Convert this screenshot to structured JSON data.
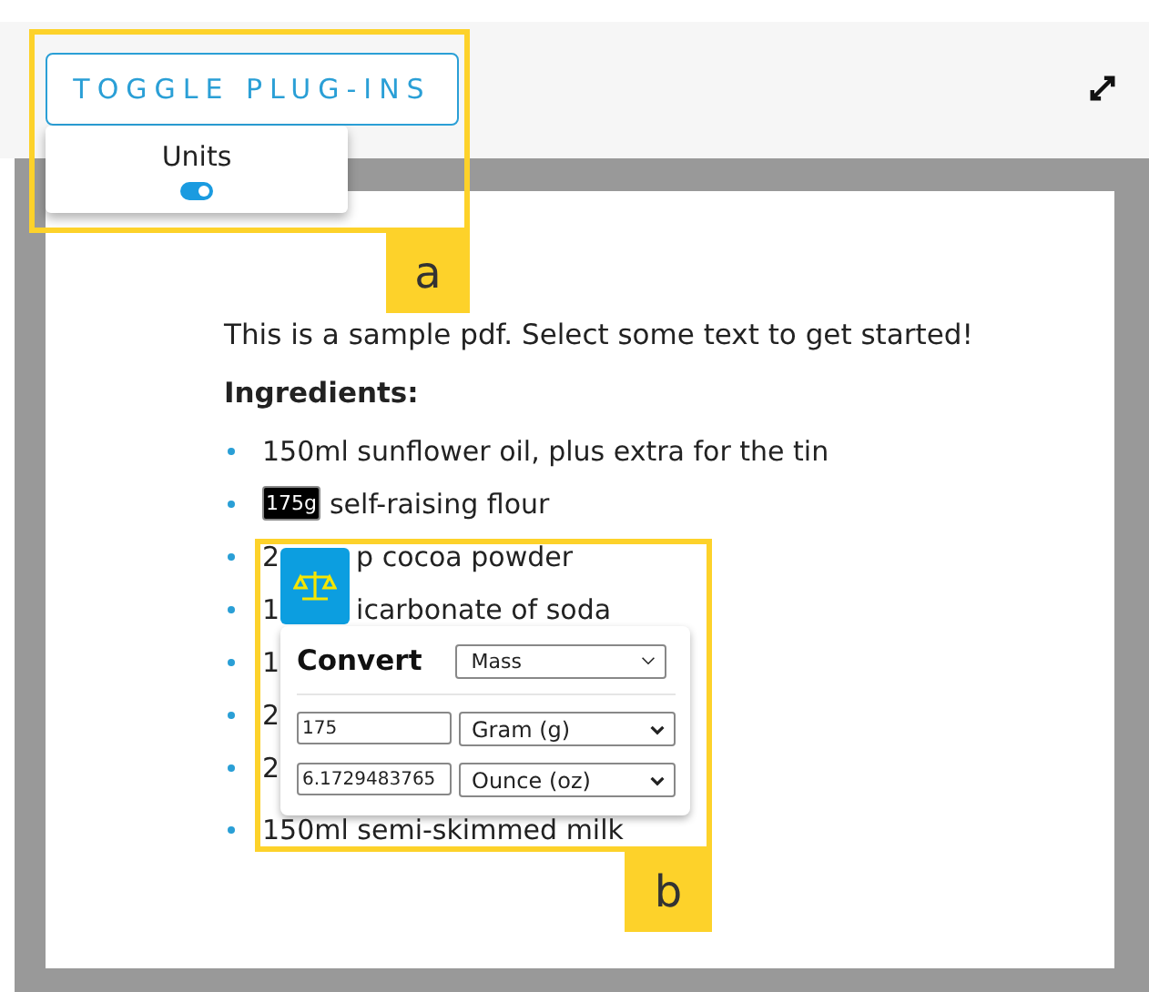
{
  "toolbar": {
    "toggle_button": "TOGGLE PLUG-INS",
    "plugins": [
      {
        "label": "Units",
        "on": true
      }
    ]
  },
  "document": {
    "intro": "This is a sample pdf. Select some text to get started!",
    "heading": "Ingredients:",
    "items": [
      {
        "kind": "plain",
        "segments": [
          {
            "text": "150ml sunflower oil, plus extra for the tin",
            "selected": false
          }
        ]
      },
      {
        "kind": "plain",
        "segments": [
          {
            "text": "175g",
            "selected": true
          },
          {
            "text": "self-raising flour",
            "selected": false
          }
        ]
      },
      {
        "kind": "covered",
        "segments": [
          {
            "text": "2",
            "selected": false
          },
          {
            "text": "p cocoa powder",
            "selected": false
          }
        ]
      },
      {
        "kind": "covered",
        "segments": [
          {
            "text": "1",
            "selected": false
          },
          {
            "text": "icarbonate of soda",
            "selected": false
          }
        ]
      },
      {
        "kind": "covered",
        "segments": [
          {
            "text": "1",
            "selected": false
          }
        ]
      },
      {
        "kind": "covered",
        "segments": [
          {
            "text": "2",
            "selected": false
          }
        ]
      },
      {
        "kind": "covered",
        "segments": [
          {
            "text": "2",
            "selected": false
          }
        ]
      },
      {
        "kind": "plain",
        "segments": [
          {
            "text": "150ml semi-skimmed milk",
            "selected": false
          }
        ]
      }
    ]
  },
  "converter": {
    "title": "Convert",
    "category": "Mass",
    "rows": [
      {
        "value": "175",
        "unit": "Gram (g)"
      },
      {
        "value": "6.1729483765",
        "unit": "Ounce (oz)"
      }
    ]
  },
  "annotations": [
    {
      "label": "a"
    },
    {
      "label": "b"
    }
  ]
}
